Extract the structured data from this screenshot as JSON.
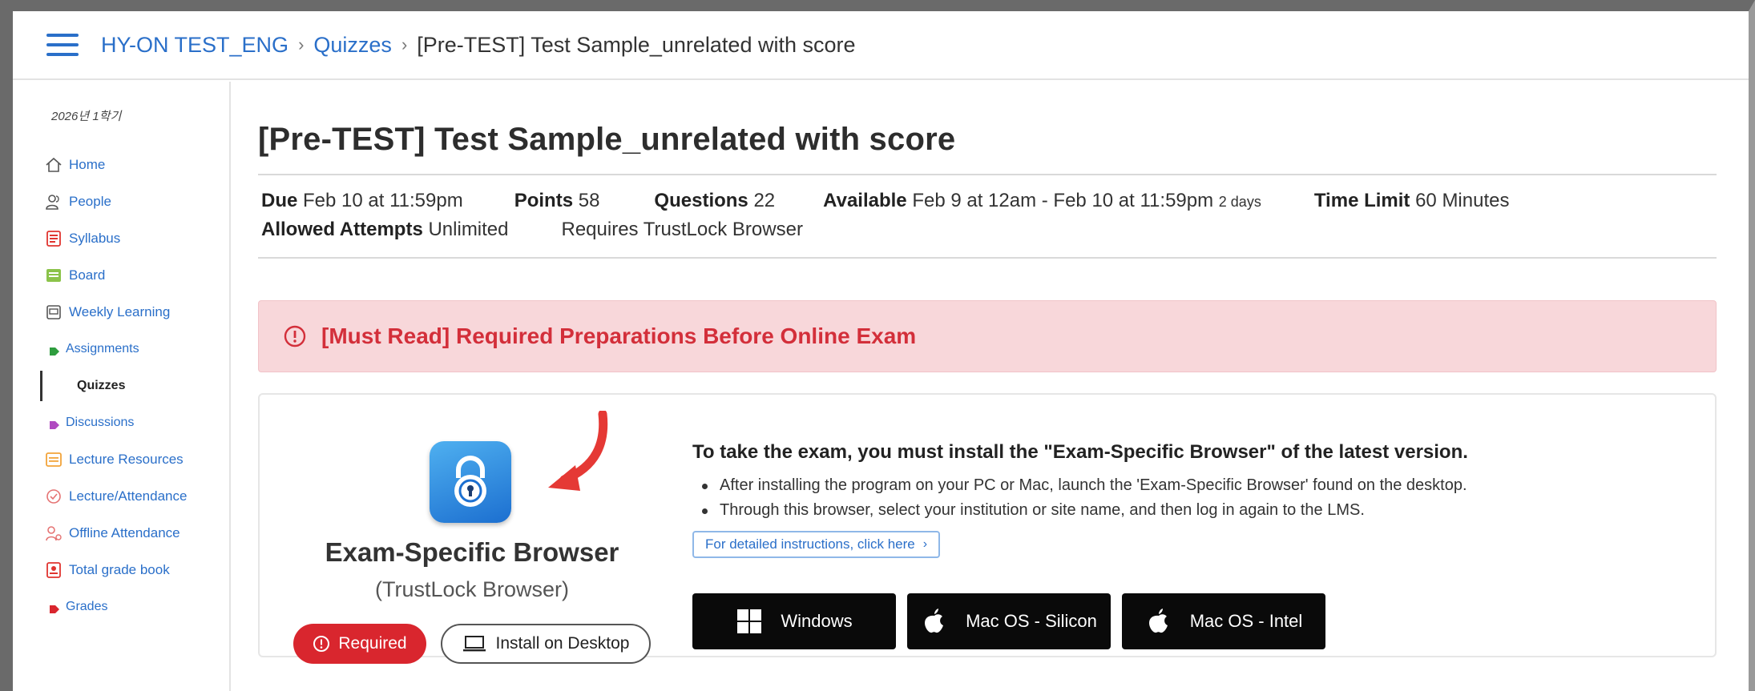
{
  "breadcrumb": {
    "course": "HY-ON TEST_ENG",
    "section": "Quizzes",
    "current": "[Pre-TEST] Test Sample_unrelated with score"
  },
  "sidebar": {
    "term": "2026년 1학기",
    "items": [
      {
        "label": "Home",
        "icon": "house-icon"
      },
      {
        "label": "People",
        "icon": "people-icon"
      },
      {
        "label": "Syllabus",
        "icon": "syllabus-icon"
      },
      {
        "label": "Board",
        "icon": "board-icon"
      },
      {
        "label": "Weekly Learning",
        "icon": "weekly-learning-icon"
      },
      {
        "label": "Assignments",
        "icon": "triangle-icon"
      },
      {
        "label": "Quizzes",
        "icon": ""
      },
      {
        "label": "Discussions",
        "icon": "triangle-icon"
      },
      {
        "label": "Lecture Resources",
        "icon": "resources-icon"
      },
      {
        "label": "Lecture/Attendance",
        "icon": "attendance-icon"
      },
      {
        "label": "Offline Attendance",
        "icon": "offline-attendance-icon"
      },
      {
        "label": "Total grade book",
        "icon": "gradebook-icon"
      },
      {
        "label": "Grades",
        "icon": "triangle-icon"
      }
    ]
  },
  "quiz": {
    "title": "[Pre-TEST] Test Sample_unrelated with score",
    "due_label": "Due",
    "due_value": "Feb 10 at 11:59pm",
    "points_label": "Points",
    "points_value": "58",
    "questions_label": "Questions",
    "questions_value": "22",
    "available_label": "Available",
    "available_value": "Feb 9 at 12am - Feb 10 at 11:59pm",
    "available_days": "2 days",
    "time_limit_label": "Time Limit",
    "time_limit_value": "60 Minutes",
    "attempts_label": "Allowed Attempts",
    "attempts_value": "Unlimited",
    "requires": "Requires TrustLock Browser"
  },
  "alert": {
    "text": "[Must Read] Required Preparations Before Online Exam"
  },
  "browser_card": {
    "name": "Exam-Specific Browser",
    "subname": "(TrustLock Browser)",
    "required_label": "Required",
    "install_label": "Install on Desktop",
    "heading": "To take the exam, you must install the \"Exam-Specific Browser\" of the latest version.",
    "bullets": [
      "After installing the program on your PC or Mac, launch the 'Exam-Specific Browser' found on the desktop.",
      "Through this browser, select your institution or site name, and then log in again to the LMS."
    ],
    "detail_link": "For detailed instructions, click here",
    "os_buttons": [
      "Windows",
      "Mac OS - Silicon",
      "Mac OS - Intel"
    ]
  },
  "colors": {
    "link": "#2a6fc9",
    "alert_bg": "#f8d7da",
    "alert_text": "#d32f3a",
    "required": "#d9262e",
    "os_button": "#0a0a0a"
  }
}
